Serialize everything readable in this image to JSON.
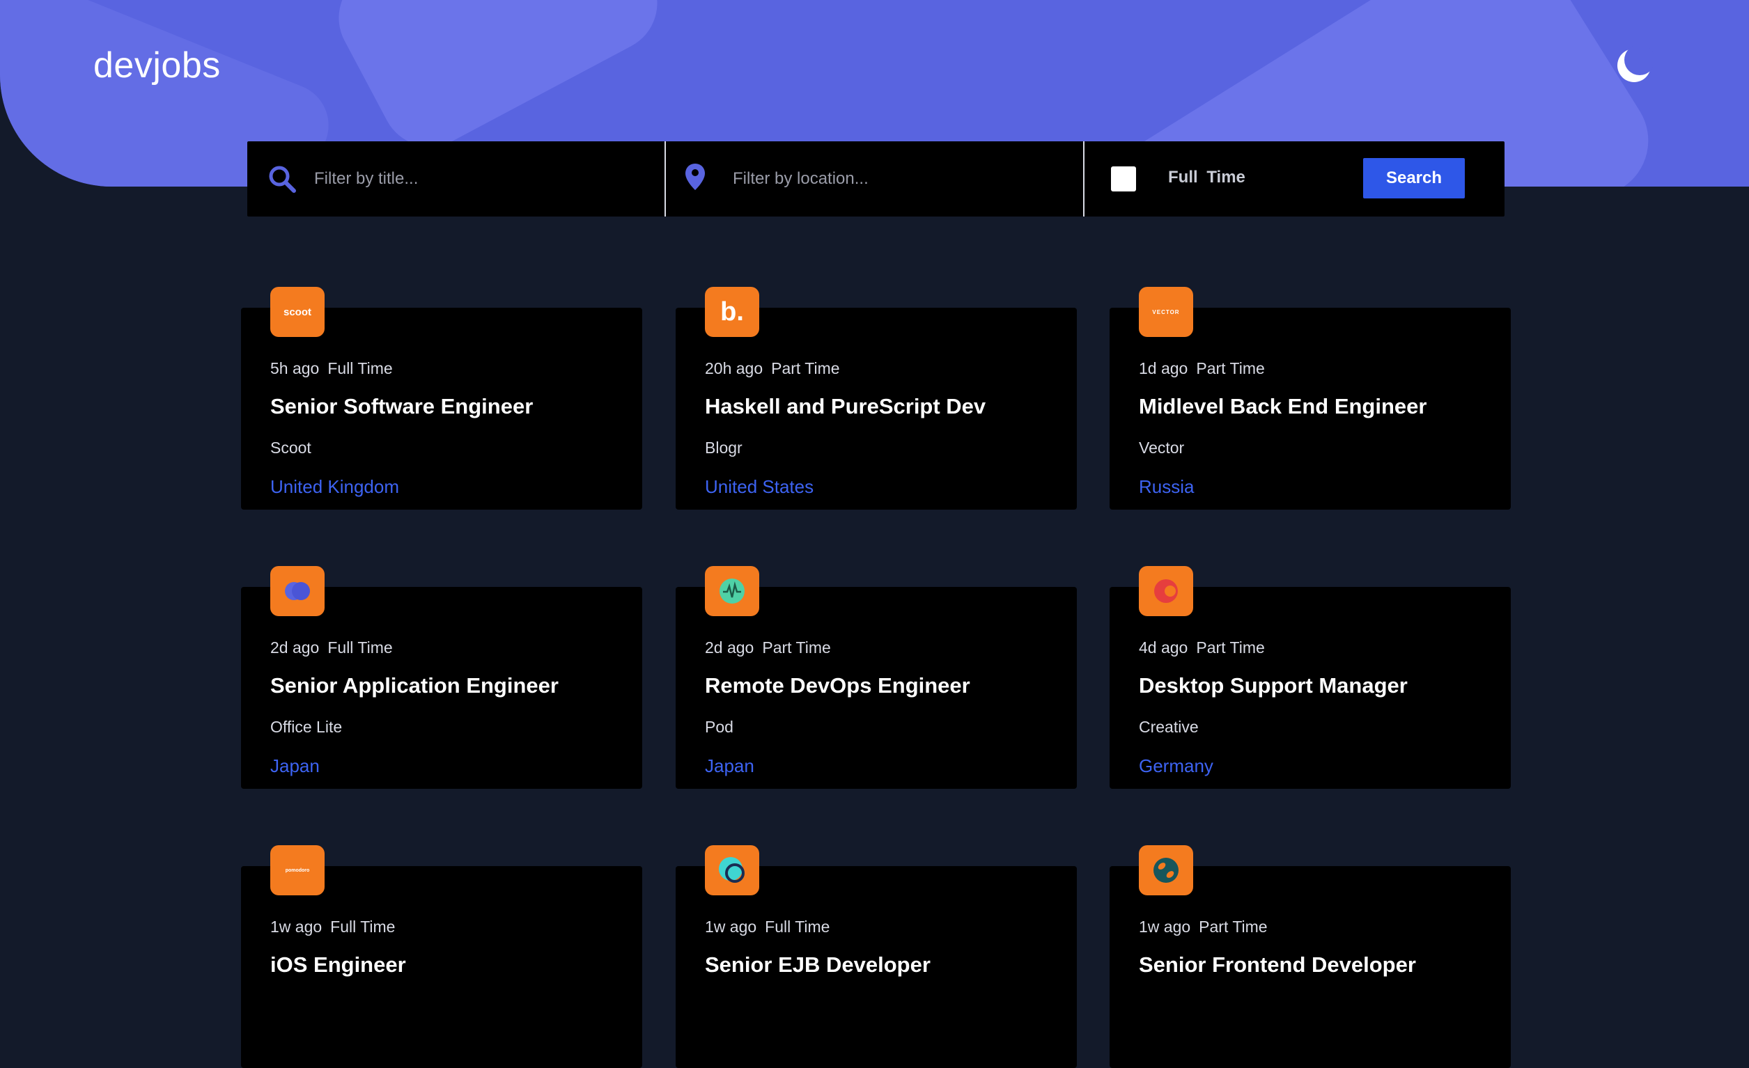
{
  "header": {
    "logo": "devjobs",
    "theme_icon": "moon-icon"
  },
  "filters": {
    "title_placeholder": "Filter by title...",
    "location_placeholder": "Filter by location...",
    "fulltime_label": "Full Time",
    "fulltime_checked": false,
    "search_label": "Search"
  },
  "jobs": [
    {
      "posted": "5h ago",
      "contract": "Full Time",
      "position": "Senior Software Engineer",
      "company": "Scoot",
      "location": "United Kingdom",
      "logo_text": "scoot",
      "logo_icon": "scoot-logo-icon"
    },
    {
      "posted": "20h ago",
      "contract": "Part Time",
      "position": "Haskell and PureScript Dev",
      "company": "Blogr",
      "location": "United States",
      "logo_text": "b.",
      "logo_icon": "blogr-logo-icon"
    },
    {
      "posted": "1d ago",
      "contract": "Part Time",
      "position": "Midlevel Back End Engineer",
      "company": "Vector",
      "location": "Russia",
      "logo_text": "VECTOR",
      "logo_icon": "vector-logo-icon"
    },
    {
      "posted": "2d ago",
      "contract": "Full Time",
      "position": "Senior Application Engineer",
      "company": "Office Lite",
      "location": "Japan",
      "logo_text": "",
      "logo_icon": "officelite-logo-icon"
    },
    {
      "posted": "2d ago",
      "contract": "Part Time",
      "position": "Remote DevOps Engineer",
      "company": "Pod",
      "location": "Japan",
      "logo_text": "",
      "logo_icon": "pod-logo-icon"
    },
    {
      "posted": "4d ago",
      "contract": "Part Time",
      "position": "Desktop Support Manager",
      "company": "Creative",
      "location": "Germany",
      "logo_text": "",
      "logo_icon": "creative-logo-icon"
    },
    {
      "posted": "1w ago",
      "contract": "Full Time",
      "position": "iOS Engineer",
      "company": "",
      "location": "",
      "logo_text": "pomodoro",
      "logo_icon": "pomodoro-logo-icon"
    },
    {
      "posted": "1w ago",
      "contract": "Full Time",
      "position": "Senior EJB Developer",
      "company": "",
      "location": "",
      "logo_text": "",
      "logo_icon": "maker-logo-icon"
    },
    {
      "posted": "1w ago",
      "contract": "Part Time",
      "position": "Senior Frontend Developer",
      "company": "",
      "location": "",
      "logo_text": "",
      "logo_icon": "coffeeroasters-logo-icon"
    }
  ],
  "colors": {
    "accent": "#5964e0",
    "logo_bg": "#f47b1f",
    "link": "#3d63f2",
    "button": "#2e57e8",
    "page_bg": "#131a2a"
  }
}
